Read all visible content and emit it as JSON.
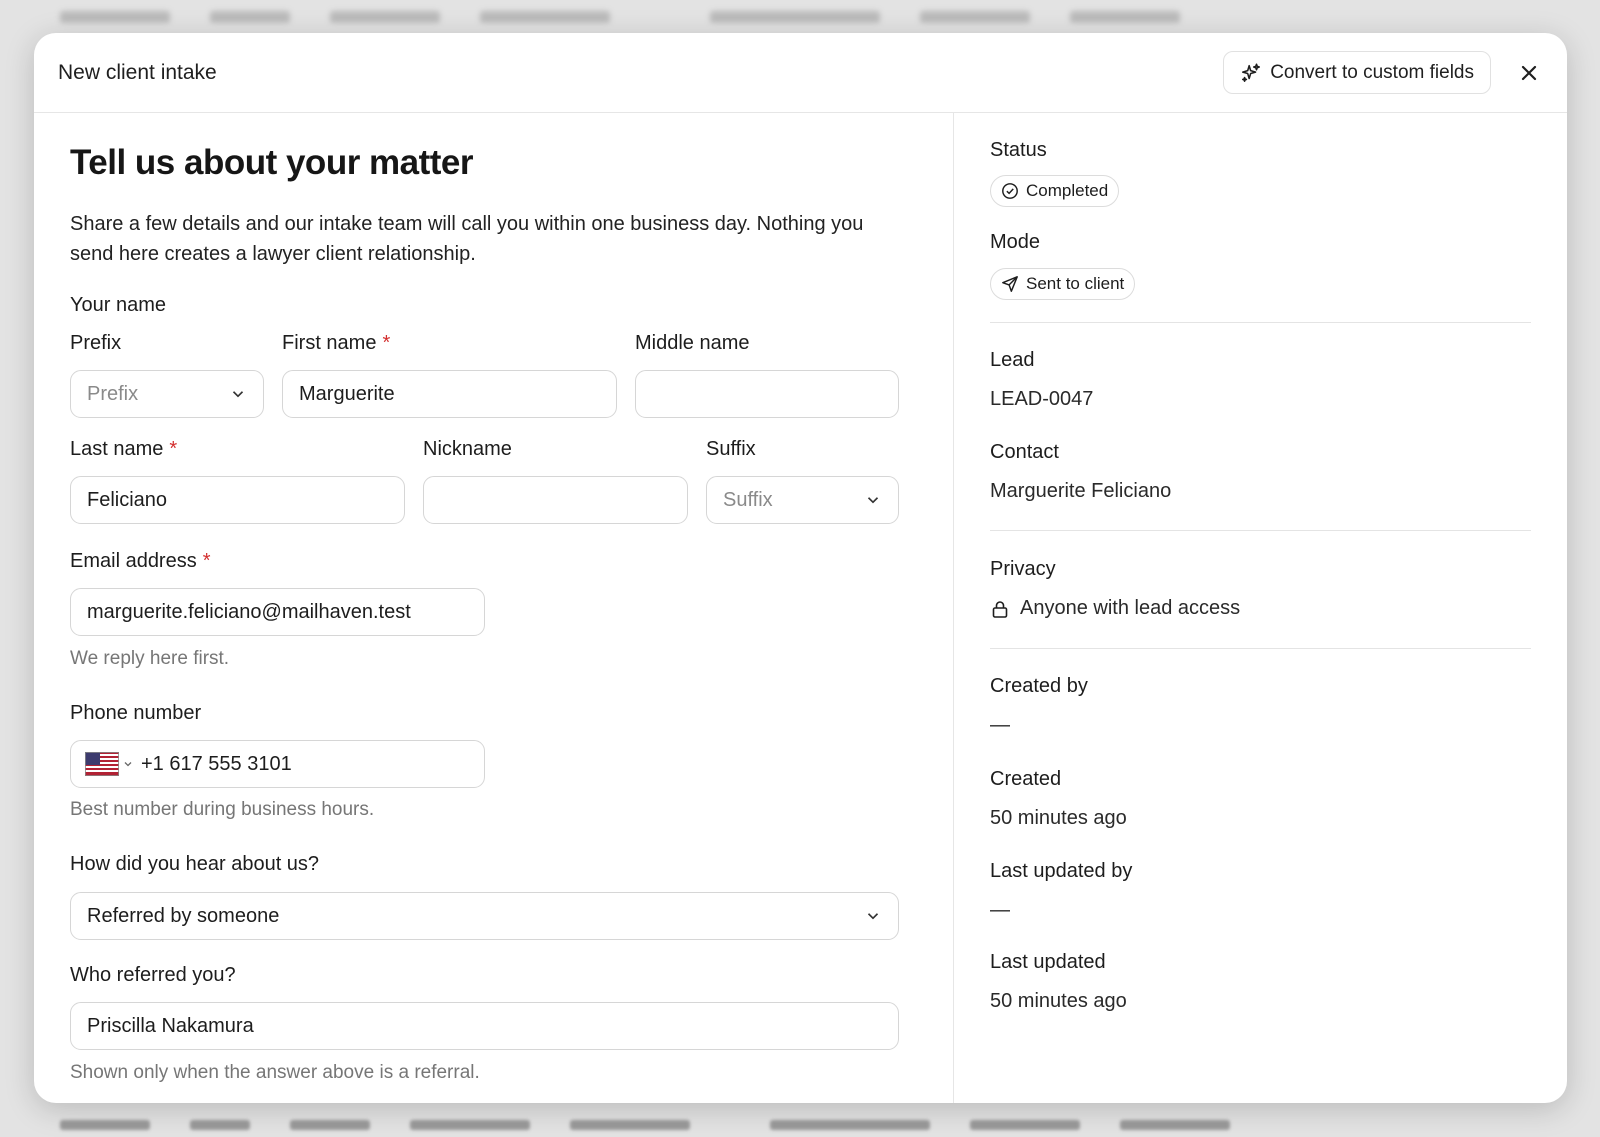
{
  "modal": {
    "title": "New client intake",
    "convert_label": "Convert to custom fields"
  },
  "form": {
    "headline": "Tell us about your matter",
    "intro": "Share a few details and our intake team will call you within one business day. Nothing you send here creates a lawyer client relationship.",
    "your_name_label": "Your name",
    "prefix": {
      "label": "Prefix",
      "placeholder": "Prefix"
    },
    "first_name": {
      "label": "First name",
      "value": "Marguerite"
    },
    "middle_name": {
      "label": "Middle name",
      "value": ""
    },
    "last_name": {
      "label": "Last name",
      "value": "Feliciano"
    },
    "nickname": {
      "label": "Nickname",
      "value": ""
    },
    "suffix": {
      "label": "Suffix",
      "placeholder": "Suffix"
    },
    "required_mark": "*",
    "email": {
      "label": "Email address",
      "value": "marguerite.feliciano@mailhaven.test",
      "help": "We reply here first."
    },
    "phone": {
      "label": "Phone number",
      "value": "+1 617 555 3101",
      "help": "Best number during business hours."
    },
    "hear": {
      "label": "How did you hear about us?",
      "value": "Referred by someone"
    },
    "referrer": {
      "label": "Who referred you?",
      "value": "Priscilla Nakamura",
      "help": "Shown only when the answer above is a referral."
    }
  },
  "side": {
    "status_label": "Status",
    "status_value": "Completed",
    "mode_label": "Mode",
    "mode_value": "Sent to client",
    "lead_label": "Lead",
    "lead_value": "LEAD-0047",
    "contact_label": "Contact",
    "contact_value": "Marguerite Feliciano",
    "privacy_label": "Privacy",
    "privacy_value": "Anyone with lead access",
    "created_by_label": "Created by",
    "created_by_value": "—",
    "created_label": "Created",
    "created_value": "50 minutes ago",
    "updated_by_label": "Last updated by",
    "updated_by_value": "—",
    "updated_label": "Last updated",
    "updated_value": "50 minutes ago"
  },
  "colors": {
    "required": "#d32f2f",
    "border": "#d6d6d6",
    "help_text": "#767676"
  }
}
